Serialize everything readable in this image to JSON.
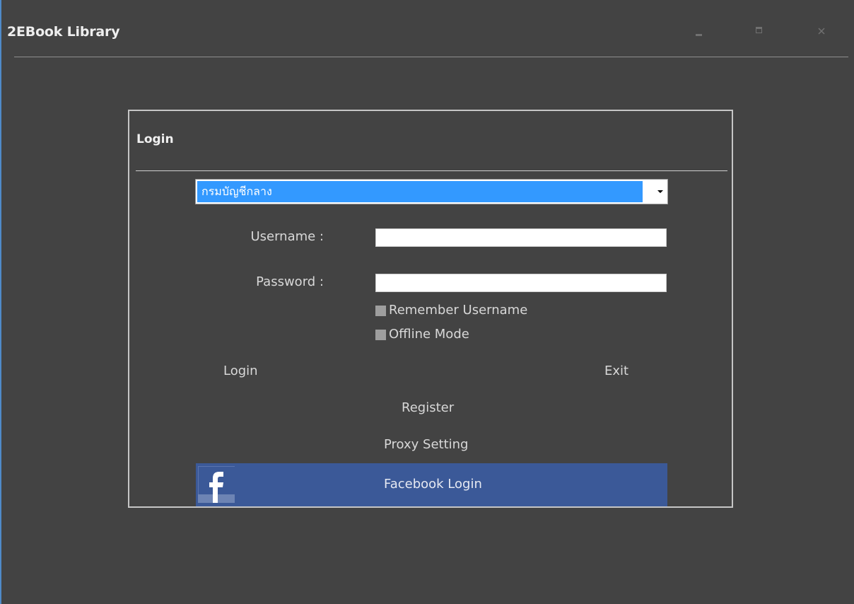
{
  "window": {
    "title": "2EBook Library",
    "controls": {
      "minimize": "minimize-icon",
      "maximize": "maximize-icon",
      "close": "close-icon"
    }
  },
  "login": {
    "panel_title": "Login",
    "organization": {
      "selected": "กรมบัญชีกลาง"
    },
    "username": {
      "label": "Username :",
      "value": ""
    },
    "password": {
      "label": "Password :",
      "value": ""
    },
    "remember_username": {
      "label": "Remember Username",
      "checked": false
    },
    "offline_mode": {
      "label": "Offline Mode",
      "checked": false
    },
    "login_button": "Login",
    "exit_button": "Exit",
    "register_button": "Register",
    "proxy_button": "Proxy Setting",
    "facebook_button": {
      "label": "Facebook Login",
      "icon": "facebook-icon"
    }
  },
  "colors": {
    "background": "#434343",
    "select_highlight": "#3399ff",
    "facebook_blue": "#3b5998",
    "text": "#d8d8d8"
  }
}
